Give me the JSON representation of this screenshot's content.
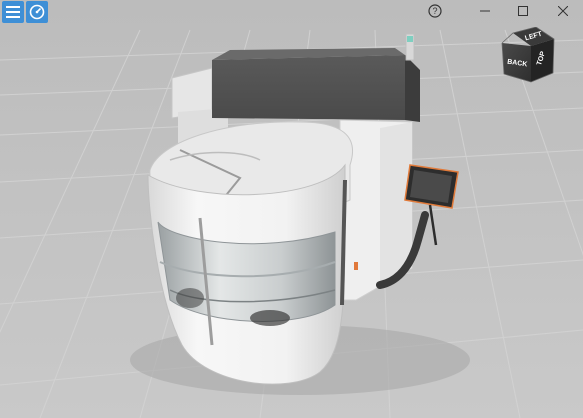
{
  "toolbar": {
    "menu_icon": "hamburger-menu-icon",
    "dashboard_icon": "speedometer-icon",
    "accent_color": "#3e8fd6"
  },
  "window_controls": {
    "help_icon": "help-circle-icon",
    "minimize_icon": "minimize-icon",
    "maximize_icon": "maximize-icon",
    "close_icon": "close-icon"
  },
  "navcube": {
    "front_label": "BACK",
    "top_label": "LEFT",
    "side_label": "TOP"
  },
  "scene": {
    "subject": "machine-model",
    "background_color": "#bdbdbd",
    "grid": true
  }
}
